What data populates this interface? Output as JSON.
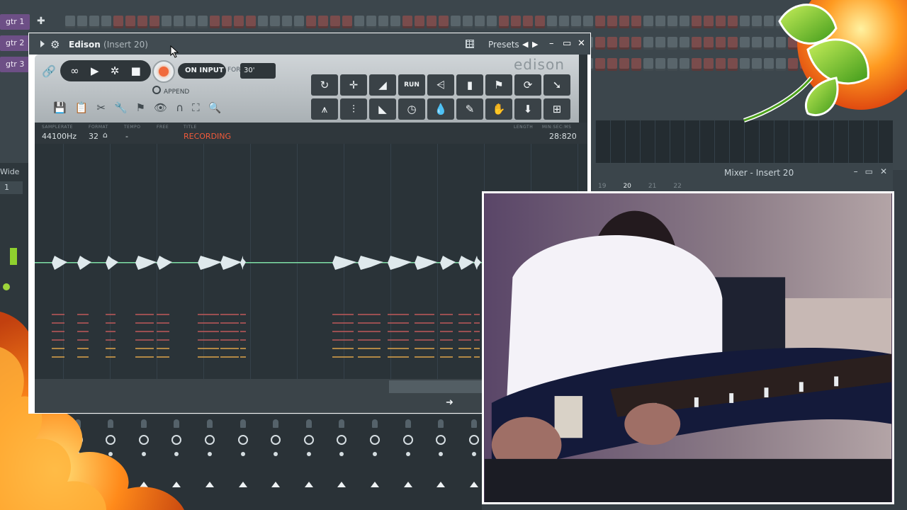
{
  "channel_rack": {
    "channels": [
      {
        "label": "gtr 1"
      },
      {
        "label": "gtr 2"
      },
      {
        "label": "gtr 3"
      }
    ]
  },
  "sidebar": {
    "wide_label": "Wide",
    "number": "1"
  },
  "edison": {
    "title": "Edison",
    "insert": "(Insert 20)",
    "presets_label": "Presets",
    "logo_text": "edison",
    "input_mode": "ON INPUT",
    "for_label": "FOR",
    "for_value": "30'",
    "append_label": "APPEND",
    "info": {
      "samplerate_caption": "SAMPLERATE",
      "samplerate": "44100Hz",
      "format_caption": "FORMAT",
      "format": "32",
      "tempo_caption": "TEMPO",
      "tempo": "-",
      "free_caption": "FREE",
      "title_caption": "TITLE",
      "title_value": "RECORDING",
      "length_caption": "LENGTH",
      "min_caption": "MIN:SEC:MS",
      "time": "28:820"
    },
    "tool_row1": [
      "loop-icon",
      "normalize-icon",
      "fade-icon",
      "run-icon",
      "noise-icon",
      "spectrum-icon",
      "marker-icon",
      "refresh-icon",
      "select-icon"
    ],
    "tool_row2": [
      "tune-icon",
      "eq-icon",
      "curve-icon",
      "clock-icon",
      "drop-icon",
      "pen-icon",
      "declick-icon",
      "save-icon",
      "fit-icon"
    ],
    "run_label": "RUN"
  },
  "mixer": {
    "title": "Mixer - Insert 20",
    "track_numbers": [
      "19",
      "20",
      "21",
      "22"
    ]
  },
  "colors": {
    "record": "#f06a3c",
    "recording_text": "#f05a3a",
    "vu_green": "#9dd43a",
    "waveform": "#dfe9ec",
    "channel_purple": "#6d4f86"
  }
}
